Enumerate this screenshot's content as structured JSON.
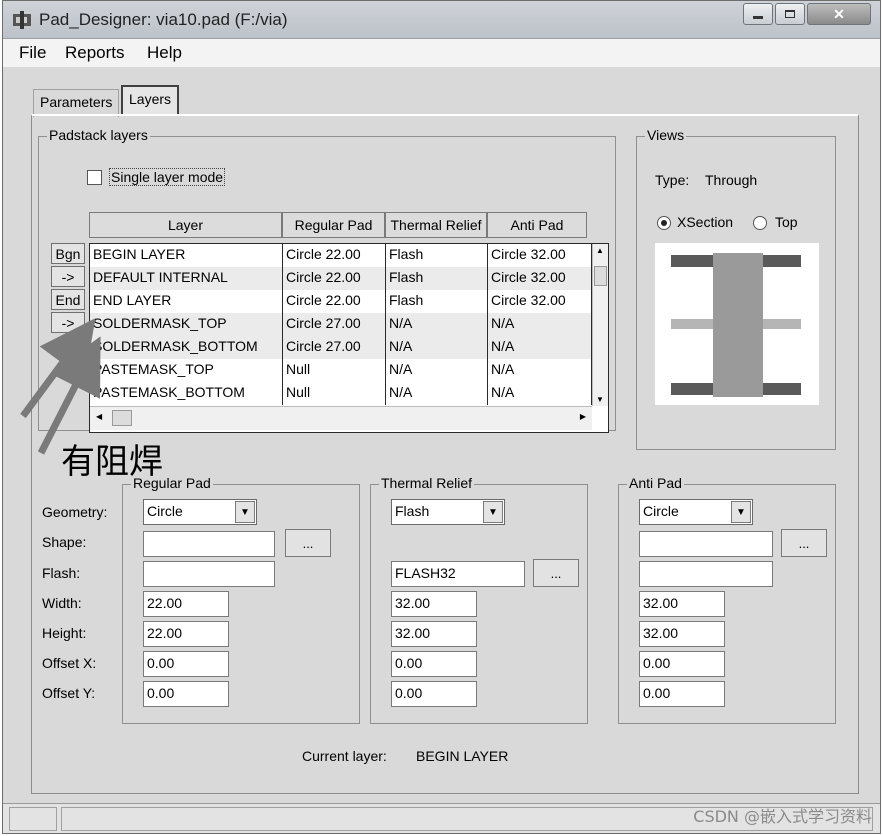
{
  "window": {
    "title": "Pad_Designer: via10.pad (F:/via)"
  },
  "menu": {
    "file": "File",
    "reports": "Reports",
    "help": "Help"
  },
  "tabs": {
    "parameters": "Parameters",
    "layers": "Layers"
  },
  "padstack": {
    "group_title": "Padstack layers",
    "single_layer_mode": "Single layer mode",
    "headers": {
      "layer": "Layer",
      "regular": "Regular Pad",
      "thermal": "Thermal Relief",
      "anti": "Anti Pad"
    },
    "side_buttons": {
      "bgn": "Bgn",
      "arrow": "->",
      "end": "End"
    },
    "rows": [
      {
        "layer": "BEGIN LAYER",
        "regular": "Circle 22.00",
        "thermal": "Flash",
        "anti": "Circle 32.00"
      },
      {
        "layer": "DEFAULT INTERNAL",
        "regular": "Circle 22.00",
        "thermal": "Flash",
        "anti": "Circle 32.00"
      },
      {
        "layer": "END LAYER",
        "regular": "Circle 22.00",
        "thermal": "Flash",
        "anti": "Circle 32.00"
      },
      {
        "layer": "SOLDERMASK_TOP",
        "regular": "Circle 27.00",
        "thermal": "N/A",
        "anti": "N/A"
      },
      {
        "layer": "SOLDERMASK_BOTTOM",
        "regular": "Circle 27.00",
        "thermal": "N/A",
        "anti": "N/A"
      },
      {
        "layer": "PASTEMASK_TOP",
        "regular": "Null",
        "thermal": "N/A",
        "anti": "N/A"
      },
      {
        "layer": "PASTEMASK_BOTTOM",
        "regular": "Null",
        "thermal": "N/A",
        "anti": "N/A"
      }
    ]
  },
  "views": {
    "group_title": "Views",
    "type_label": "Type:",
    "type_value": "Through",
    "xsection": "XSection",
    "top": "Top",
    "selected": "XSection"
  },
  "annotation": {
    "text": "有阻焊"
  },
  "labels": {
    "geometry": "Geometry:",
    "shape": "Shape:",
    "flash": "Flash:",
    "width": "Width:",
    "height": "Height:",
    "offset_x": "Offset X:",
    "offset_y": "Offset Y:"
  },
  "regular_pad": {
    "title": "Regular Pad",
    "geometry": "Circle",
    "shape": "",
    "flash": "",
    "width": "22.00",
    "height": "22.00",
    "offset_x": "0.00",
    "offset_y": "0.00",
    "browse": "..."
  },
  "thermal_relief": {
    "title": "Thermal Relief",
    "geometry": "Flash",
    "flash": "FLASH32",
    "width": "32.00",
    "height": "32.00",
    "offset_x": "0.00",
    "offset_y": "0.00",
    "browse": "..."
  },
  "anti_pad": {
    "title": "Anti Pad",
    "geometry": "Circle",
    "shape": "",
    "flash": "",
    "width": "32.00",
    "height": "32.00",
    "offset_x": "0.00",
    "offset_y": "0.00",
    "browse": "..."
  },
  "current_layer": {
    "label": "Current layer:",
    "value": "BEGIN LAYER"
  },
  "watermark": "CSDN @嵌入式学习资料"
}
